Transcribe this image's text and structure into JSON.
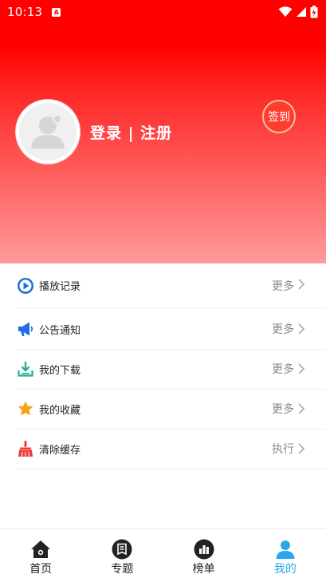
{
  "status_bar": {
    "time": "10:13",
    "notification_icon": "A"
  },
  "profile": {
    "login_text": "登录 | 注册",
    "signin_label": "签到"
  },
  "menu": [
    {
      "icon": "play-circle-icon",
      "label": "播放记录",
      "action": "更多"
    },
    {
      "icon": "megaphone-icon",
      "label": "公告通知",
      "action": "更多"
    },
    {
      "icon": "download-icon",
      "label": "我的下载",
      "action": "更多"
    },
    {
      "icon": "star-icon",
      "label": "我的收藏",
      "action": "更多"
    },
    {
      "icon": "broom-icon",
      "label": "清除缓存",
      "action": "执行"
    }
  ],
  "nav": [
    {
      "icon": "home-icon",
      "label": "首页"
    },
    {
      "icon": "topic-icon",
      "label": "专题"
    },
    {
      "icon": "ranking-icon",
      "label": "榜单"
    },
    {
      "icon": "user-icon",
      "label": "我的",
      "active": true
    }
  ],
  "colors": {
    "primary_red": "#ff0000",
    "accent_blue": "#29a7ea",
    "menu_text": "#222222",
    "secondary_text": "#888888"
  }
}
